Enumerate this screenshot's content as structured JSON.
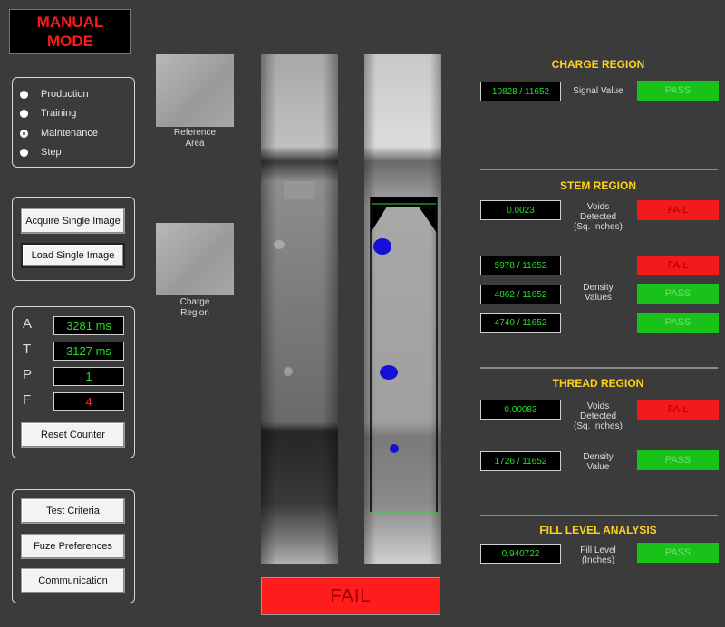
{
  "mode": {
    "line1": "MANUAL",
    "line2": "MODE"
  },
  "radio_options": [
    {
      "label": "Production",
      "checked": false
    },
    {
      "label": "Training",
      "checked": false
    },
    {
      "label": "Maintenance",
      "checked": true
    },
    {
      "label": "Step",
      "checked": false
    }
  ],
  "buttons": {
    "acquire": "Acquire Single Image",
    "load": "Load Single Image",
    "reset": "Reset Counter",
    "test_criteria": "Test Criteria",
    "fuze_prefs": "Fuze Preferences",
    "communication": "Communication"
  },
  "counters": [
    {
      "label": "A",
      "value": "3281 ms",
      "color": "#22e022"
    },
    {
      "label": "T",
      "value": "3127 ms",
      "color": "#22e022"
    },
    {
      "label": "P",
      "value": "1",
      "color": "#22e022"
    },
    {
      "label": "F",
      "value": "4",
      "color": "#ff2a2a"
    }
  ],
  "thumbnails": {
    "reference_line1": "Reference",
    "reference_line2": "Area",
    "charge_line1": "Charge",
    "charge_line2": "Region"
  },
  "result_banner": "FAIL",
  "charge_region": {
    "title": "CHARGE REGION",
    "signal_value": "10828 / 11652",
    "signal_label": "Signal Value",
    "status": "PASS"
  },
  "stem_region": {
    "title": "STEM REGION",
    "voids_value": "0.0023",
    "voids_label_1": "Voids",
    "voids_label_2": "Detected",
    "voids_label_3": "(Sq. Inches)",
    "voids_status": "FAIL",
    "density_label_1": "Density",
    "density_label_2": "Values",
    "density": [
      {
        "value": "5978 / 11652",
        "status": "FAIL"
      },
      {
        "value": "4862 / 11652",
        "status": "PASS"
      },
      {
        "value": "4740 / 11652",
        "status": "PASS"
      }
    ]
  },
  "thread_region": {
    "title": "THREAD REGION",
    "voids_value": "0.00083",
    "voids_label_1": "Voids",
    "voids_label_2": "Detected",
    "voids_label_3": "(Sq. Inches)",
    "voids_status": "FAIL",
    "density_value": "1726 / 11652",
    "density_label_1": "Density",
    "density_label_2": "Value",
    "density_status": "PASS"
  },
  "fill_level": {
    "title": "FILL LEVEL ANALYSIS",
    "value": "0.940722",
    "label_1": "Fill Level",
    "label_2": "(Inches)",
    "status": "PASS"
  },
  "colors": {
    "background": "#3b3b3b",
    "lcd_green": "#22e022",
    "pass_green": "#19c219",
    "fail_red": "#f21a1a",
    "title_yellow": "#ffd21a",
    "void_blue": "#1510d6"
  }
}
